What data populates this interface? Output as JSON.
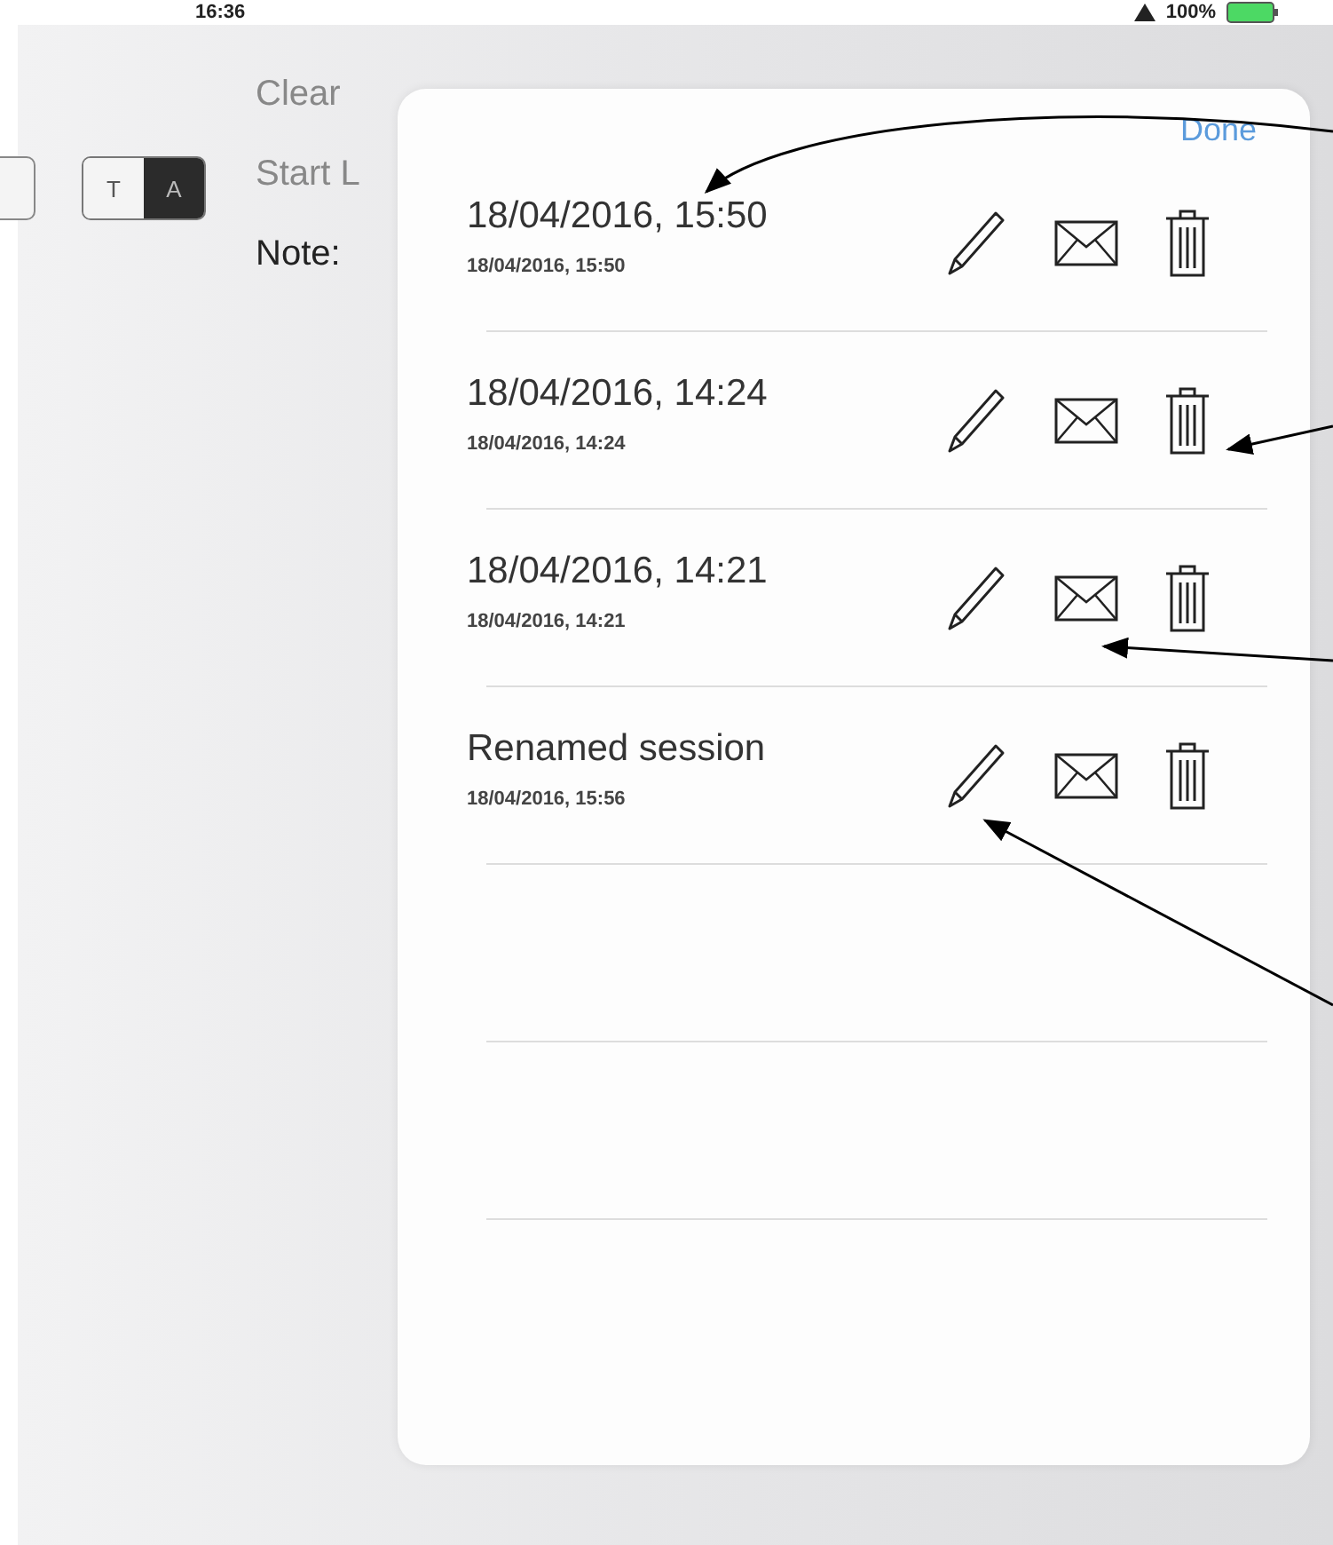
{
  "status_bar": {
    "time": "16:36",
    "battery": "100%"
  },
  "background": {
    "actions": [
      "Clear",
      "Start L"
    ],
    "note_label": "Note:",
    "segments": [
      {
        "label": "T",
        "selected": false
      },
      {
        "label": "A",
        "selected": true
      }
    ]
  },
  "popover": {
    "done": "Done",
    "sessions": [
      {
        "title": "18/04/2016, 15:50",
        "subtitle": "18/04/2016, 15:50"
      },
      {
        "title": "18/04/2016, 14:24",
        "subtitle": "18/04/2016, 14:24"
      },
      {
        "title": "18/04/2016, 14:21",
        "subtitle": "18/04/2016, 14:21"
      },
      {
        "title": "Renamed session",
        "subtitle": "18/04/2016, 15:56"
      }
    ]
  }
}
